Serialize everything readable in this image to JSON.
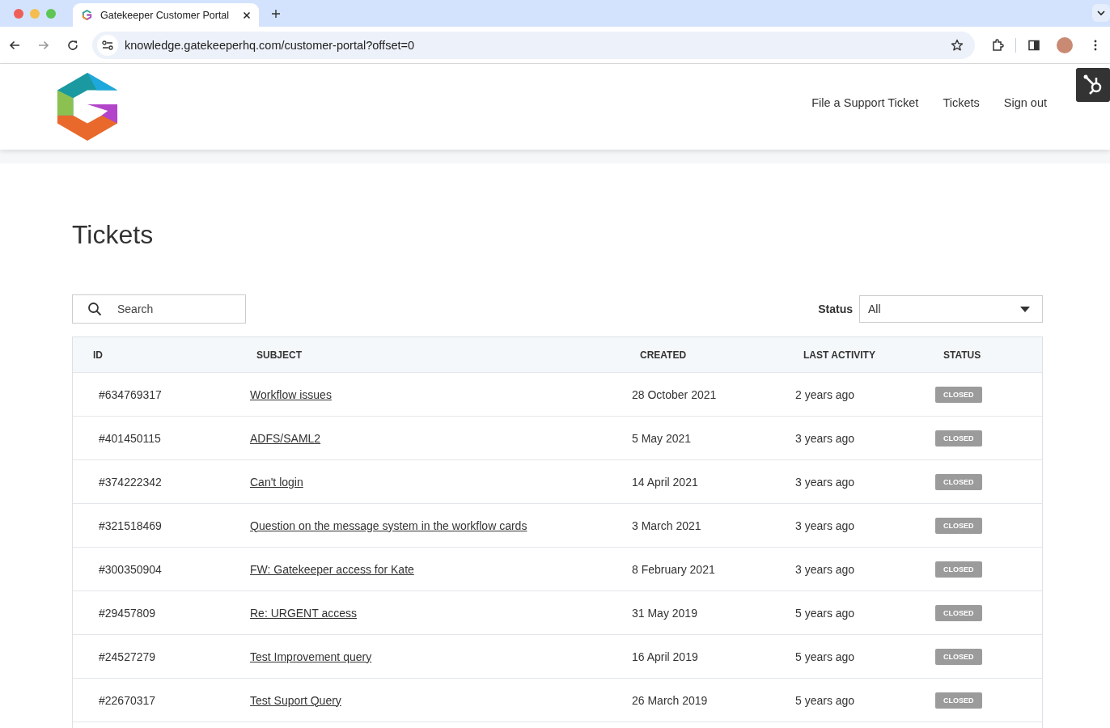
{
  "browser": {
    "tab_title": "Gatekeeper Customer Portal",
    "url": "knowledge.gatekeeperhq.com/customer-portal?offset=0"
  },
  "nav": {
    "links": [
      "File a Support Ticket",
      "Tickets",
      "Sign out"
    ]
  },
  "page_title": "Tickets",
  "search": {
    "placeholder": "Search"
  },
  "status_filter": {
    "label": "Status",
    "value": "All"
  },
  "table": {
    "columns": [
      "ID",
      "SUBJECT",
      "CREATED",
      "LAST ACTIVITY",
      "STATUS"
    ],
    "rows": [
      {
        "id": "#634769317",
        "subject": "Workflow issues",
        "created": "28 October 2021",
        "last_activity": "2 years ago",
        "status": "CLOSED"
      },
      {
        "id": "#401450115",
        "subject": "ADFS/SAML2",
        "created": "5 May 2021",
        "last_activity": "3 years ago",
        "status": "CLOSED"
      },
      {
        "id": "#374222342",
        "subject": "Can't login",
        "created": "14 April 2021",
        "last_activity": "3 years ago",
        "status": "CLOSED"
      },
      {
        "id": "#321518469",
        "subject": "Question on the message system in the workflow cards",
        "created": "3 March 2021",
        "last_activity": "3 years ago",
        "status": "CLOSED"
      },
      {
        "id": "#300350904",
        "subject": "FW: Gatekeeper access for Kate",
        "created": "8 February 2021",
        "last_activity": "3 years ago",
        "status": "CLOSED"
      },
      {
        "id": "#29457809",
        "subject": "Re: URGENT access",
        "created": "31 May 2019",
        "last_activity": "5 years ago",
        "status": "CLOSED"
      },
      {
        "id": "#24527279",
        "subject": "Test Improvement query",
        "created": "16 April 2019",
        "last_activity": "5 years ago",
        "status": "CLOSED"
      },
      {
        "id": "#22670317",
        "subject": "Test Suport Query",
        "created": "26 March 2019",
        "last_activity": "5 years ago",
        "status": "CLOSED"
      }
    ]
  }
}
